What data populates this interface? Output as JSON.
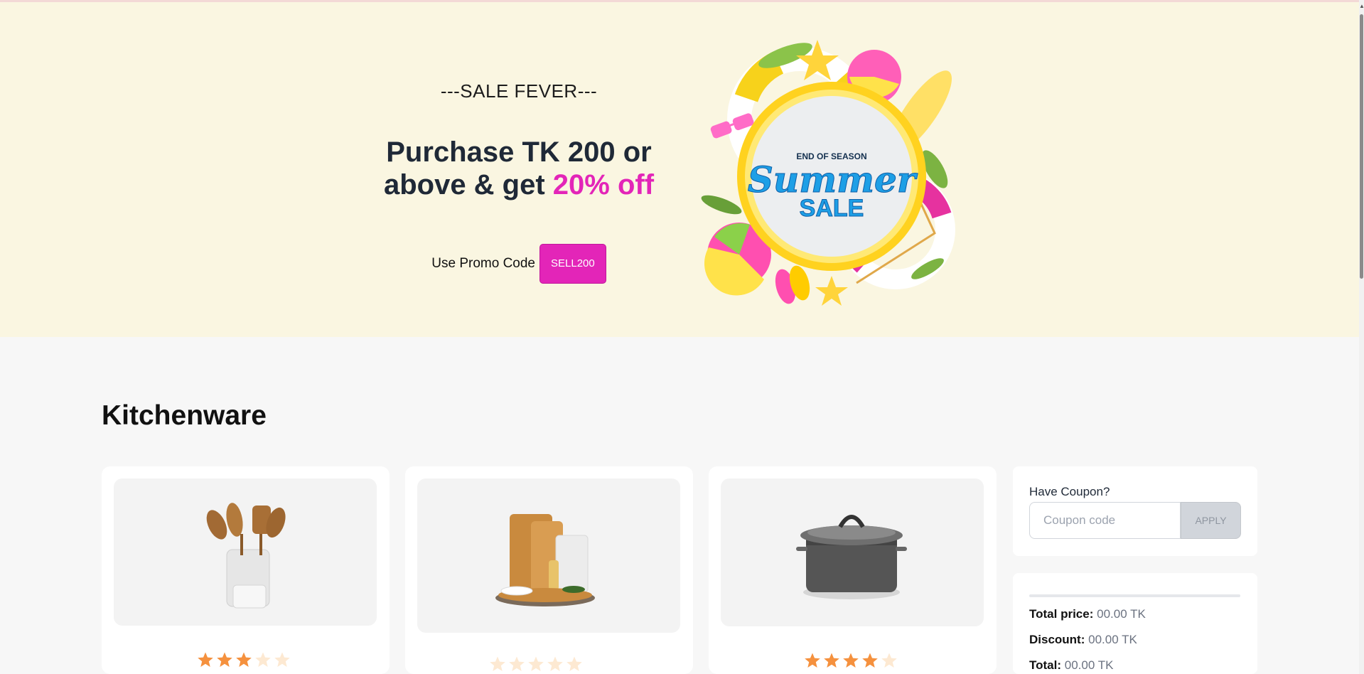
{
  "hero": {
    "eyebrow": "---SALE FEVER---",
    "headline_main": "Purchase TK 200 or above & get",
    "headline_highlight": "20% off",
    "promo_label": "Use Promo Code",
    "promo_code": "SELL200",
    "banner_line1": "END OF SEASON",
    "banner_line2": "Summer",
    "banner_line3": "SALE"
  },
  "section": {
    "title": "Kitchenware"
  },
  "products": [
    {
      "image": "kitchen-utensil-set",
      "rating": 3
    },
    {
      "image": "wooden-cutting-board-set",
      "rating": 0
    },
    {
      "image": "steel-cooking-pot",
      "rating": 4
    }
  ],
  "coupon": {
    "label": "Have Coupon?",
    "placeholder": "Coupon code",
    "apply_label": "APPLY"
  },
  "summary": {
    "total_price_label": "Total price:",
    "total_price_value": "00.00 TK",
    "discount_label": "Discount:",
    "discount_value": "00.00 TK",
    "total_label": "Total:",
    "total_value": "00.00 TK"
  },
  "colors": {
    "accent": "#e325b8",
    "star_filled": "#f5913e",
    "star_empty": "#fde9d2",
    "hero_bg": "#faf6e1"
  }
}
